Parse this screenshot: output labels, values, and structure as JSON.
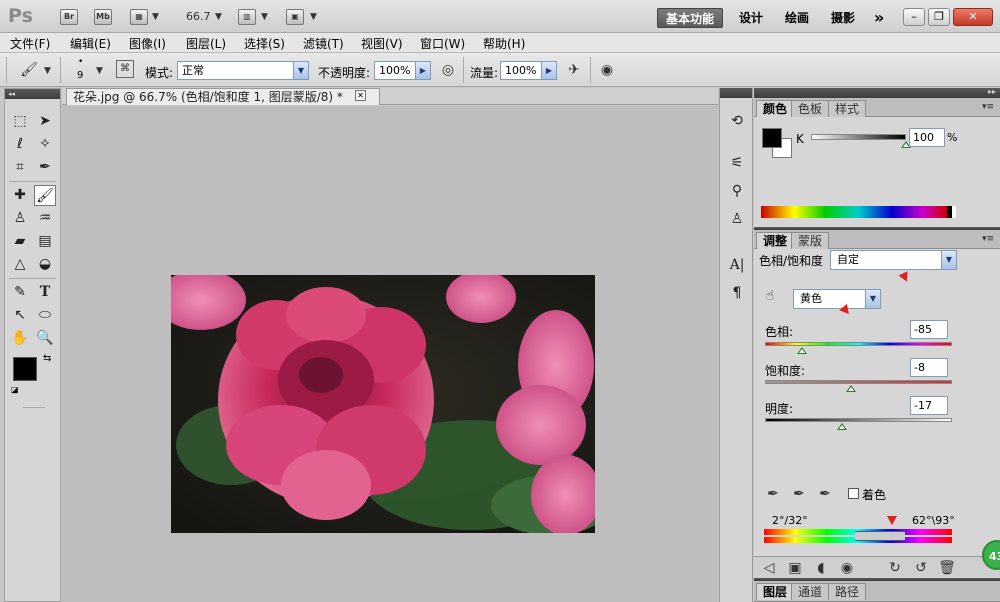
{
  "app": {
    "logo": "Ps",
    "bridge_label": "Br",
    "minibridge_label": "Mb",
    "zoom": "66.7",
    "workspaces": [
      "基本功能",
      "设计",
      "绘画",
      "摄影"
    ],
    "more": "»",
    "win_min": "–",
    "win_max": "❐",
    "win_close": "✕"
  },
  "menu": [
    "文件(F)",
    "编辑(E)",
    "图像(I)",
    "图层(L)",
    "选择(S)",
    "滤镜(T)",
    "视图(V)",
    "窗口(W)",
    "帮助(H)"
  ],
  "options": {
    "brush_size": "9",
    "mode_label": "模式:",
    "mode_value": "正常",
    "opacity_label": "不透明度:",
    "opacity_value": "100%",
    "flow_label": "流量:",
    "flow_value": "100%"
  },
  "document": {
    "tab_title": "花朵.jpg @ 66.7% (色相/饱和度 1, 图层蒙版/8) *",
    "close": "✕"
  },
  "color_panel": {
    "tabs": [
      "颜色",
      "色板",
      "样式"
    ],
    "channel": "K",
    "k_value": "100",
    "k_level": 100,
    "unit": "%"
  },
  "adjust_panel": {
    "tabs": [
      "调整",
      "蒙版"
    ],
    "title": "色相/饱和度",
    "preset": "自定",
    "channel": "黄色",
    "hue_label": "色相:",
    "hue_value": "-85",
    "sat_label": "饱和度:",
    "sat_value": "-8",
    "light_label": "明度:",
    "light_value": "-17",
    "colorize_label": "着色",
    "range_left": "2°/32°",
    "range_right": "62°\\93°"
  },
  "layers_panel": {
    "tabs": [
      "图层",
      "通道",
      "路径"
    ]
  },
  "badge": "43",
  "colors": {
    "accent_red": "#e02020",
    "badge_green": "#3cb04a"
  }
}
